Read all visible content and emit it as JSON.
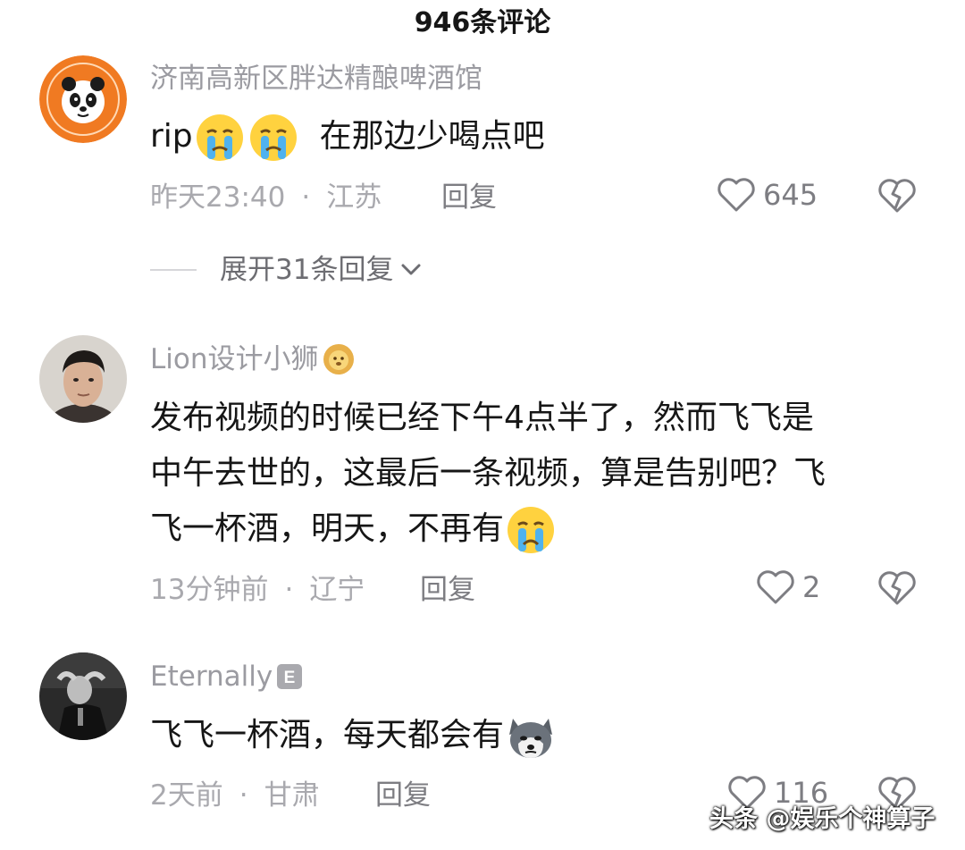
{
  "header": {
    "title": "946条评论"
  },
  "comments": [
    {
      "username": "济南高新区胖达精酿啤酒馆",
      "text_prefix": "rip",
      "text_suffix": "在那边少喝点吧",
      "avatar": "panda-logo-avatar",
      "emojis": [
        "crying-emoji",
        "crying-emoji"
      ],
      "time": "昨天23:40",
      "location": "江苏",
      "reply_label": "回复",
      "likes": "645",
      "expand_label": "展开31条回复"
    },
    {
      "username": "Lion设计小狮",
      "username_badge": "lion-emoji",
      "line1": "发布视频的时候已经下午4点半了，然而飞飞是",
      "line2": "中午去世的，这最后一条视频，算是告别吧？飞",
      "line3": "飞一杯酒，明天，不再有",
      "avatar": "man-photo-avatar",
      "emojis": [
        "crying-emoji"
      ],
      "time": "13分钟前",
      "location": "辽宁",
      "reply_label": "回复",
      "likes": "2"
    },
    {
      "username": "Eternally",
      "username_badge": "E",
      "text": "飞飞一杯酒，每天都会有",
      "avatar": "dark-photo-avatar",
      "emojis": [
        "husky-dog-emoji"
      ],
      "time": "2天前",
      "location": "甘肃",
      "reply_label": "回复",
      "likes": "116"
    }
  ],
  "separator": "·",
  "watermark": "头条 @娱乐个神算子",
  "colors": {
    "meta_text": "#a9a9ae",
    "username_text": "#9b9ba1",
    "body_text": "#161616",
    "panda_avatar_bg": "#f07a22"
  }
}
